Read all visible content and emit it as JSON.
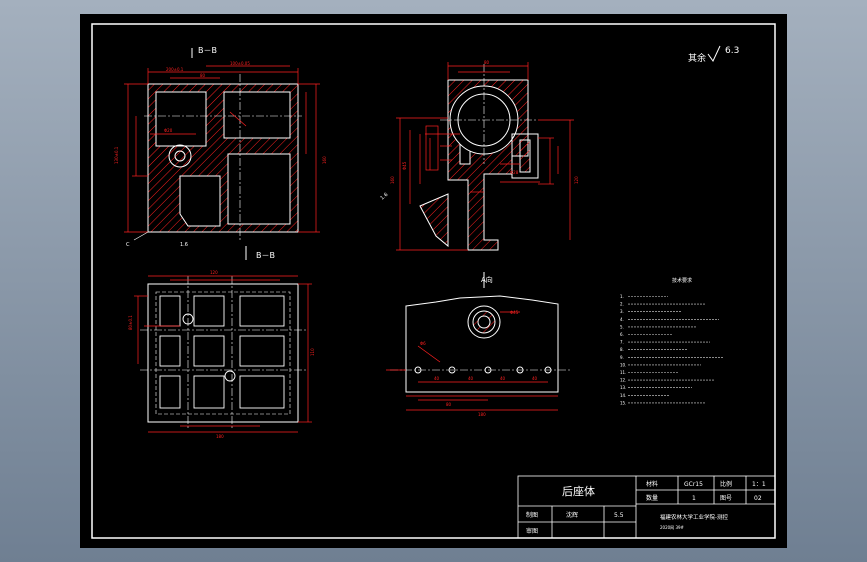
{
  "drawing": {
    "colors": {
      "line": "#ffffff",
      "dim": "#ff2020",
      "hatch": "#ff2020",
      "bg": "#000000",
      "outer": "#8a98aa"
    },
    "section_b": "B－B",
    "section_bb": "B－B",
    "view_a": "A向",
    "roughness_prefix": "其余",
    "roughness_value": "6.3",
    "notes_title": "技术要求",
    "notes": [
      "1.",
      "2.",
      "3.",
      "4.",
      "5.",
      "6.",
      "7.",
      "8.",
      "9.",
      "10.",
      "11.",
      "12.",
      "13.",
      "14.",
      "15."
    ],
    "title_block": {
      "part_name": "后座体",
      "material_label": "材料",
      "material_value": "GCr15",
      "scale_label": "比例",
      "scale_value": "1：1",
      "qty_label": "数量",
      "qty_value": "1",
      "drawing_no_label": "图号",
      "drawing_no_value": "02",
      "drawn_label": "制图",
      "drawn_name": "沈辉",
      "drawn_date": "5.5",
      "checked_label": "审图",
      "school": "福建农林大学工业学院-测控",
      "class_code": "2020网 39#"
    }
  }
}
